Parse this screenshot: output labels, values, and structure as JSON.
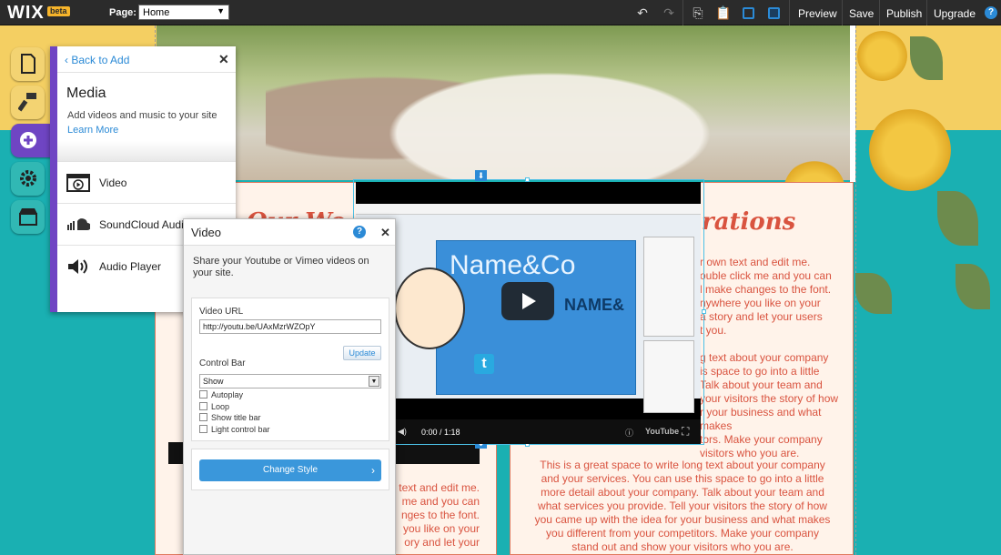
{
  "topbar": {
    "logo": "WIX",
    "beta": "beta",
    "page_label": "Page:",
    "page_value": "Home",
    "buttons": {
      "preview": "Preview",
      "save": "Save",
      "publish": "Publish",
      "upgrade": "Upgrade"
    }
  },
  "left_toolbar": {
    "items": [
      {
        "name": "pages-icon",
        "color": "#f3d372"
      },
      {
        "name": "design-icon",
        "color": "#f3d372"
      },
      {
        "name": "add-icon",
        "color": "#6f45c3"
      },
      {
        "name": "settings-icon",
        "color": "#31b8b4"
      },
      {
        "name": "app-market-icon",
        "color": "#31b8b4"
      }
    ]
  },
  "add_panel": {
    "back": "Back to Add",
    "title": "Media",
    "subtitle": "Add videos and music to your site",
    "learn_more": "Learn More",
    "items": [
      {
        "label": "Video",
        "icon": "video-icon"
      },
      {
        "label": "SoundCloud Audio",
        "icon": "soundcloud-icon"
      },
      {
        "label": "Audio Player",
        "icon": "speaker-icon"
      }
    ]
  },
  "video_panel": {
    "title": "Video",
    "help": "?",
    "description": "Share your Youtube or Vimeo videos on your site.",
    "url_label": "Video URL",
    "url_value": "http://youtu.be/UAxMzrWZOpY",
    "update": "Update",
    "control_bar_label": "Control Bar",
    "control_bar_value": "Show",
    "checkboxes": [
      "Autoplay",
      "Loop",
      "Show title bar",
      "Light control bar"
    ],
    "change_style": "Change Style"
  },
  "video_player": {
    "time": "0:00 / 1:18",
    "brand_title": "Name&Co",
    "sign": "NAME&"
  },
  "site": {
    "left_card_title": "Our Wo",
    "right_card_title": "rations",
    "right_top_text": [
      "r own text and edit me.",
      "ouble click me and you can",
      "l make changes to the font.",
      "nywhere you like on your",
      "a story and let your users",
      "t you."
    ],
    "right_mid_text": [
      "g text about your company",
      "is space to go into a little",
      "Talk about your team and",
      "your visitors the story of how",
      "r your business and what makes",
      "tors. Make your company",
      "visitors who you are."
    ],
    "right_bottom_text": [
      "This is a great space to write long text about your company",
      "and your services. You can use this space to go into a little",
      "more detail about your company. Talk about your team and",
      "what services you provide. Tell your visitors the story of how",
      "you came up with the idea for your business and what makes",
      "you different from your competitors. Make your company",
      "stand out and show your visitors who you are."
    ],
    "left_bottom_text": [
      "text and edit me.",
      "me and you can",
      "nges to the font.",
      "you like on your",
      "ory and let your"
    ],
    "colors": {
      "accent": "#d9533f",
      "teal": "#1ab0b2",
      "yellow": "#f4cf62"
    }
  }
}
